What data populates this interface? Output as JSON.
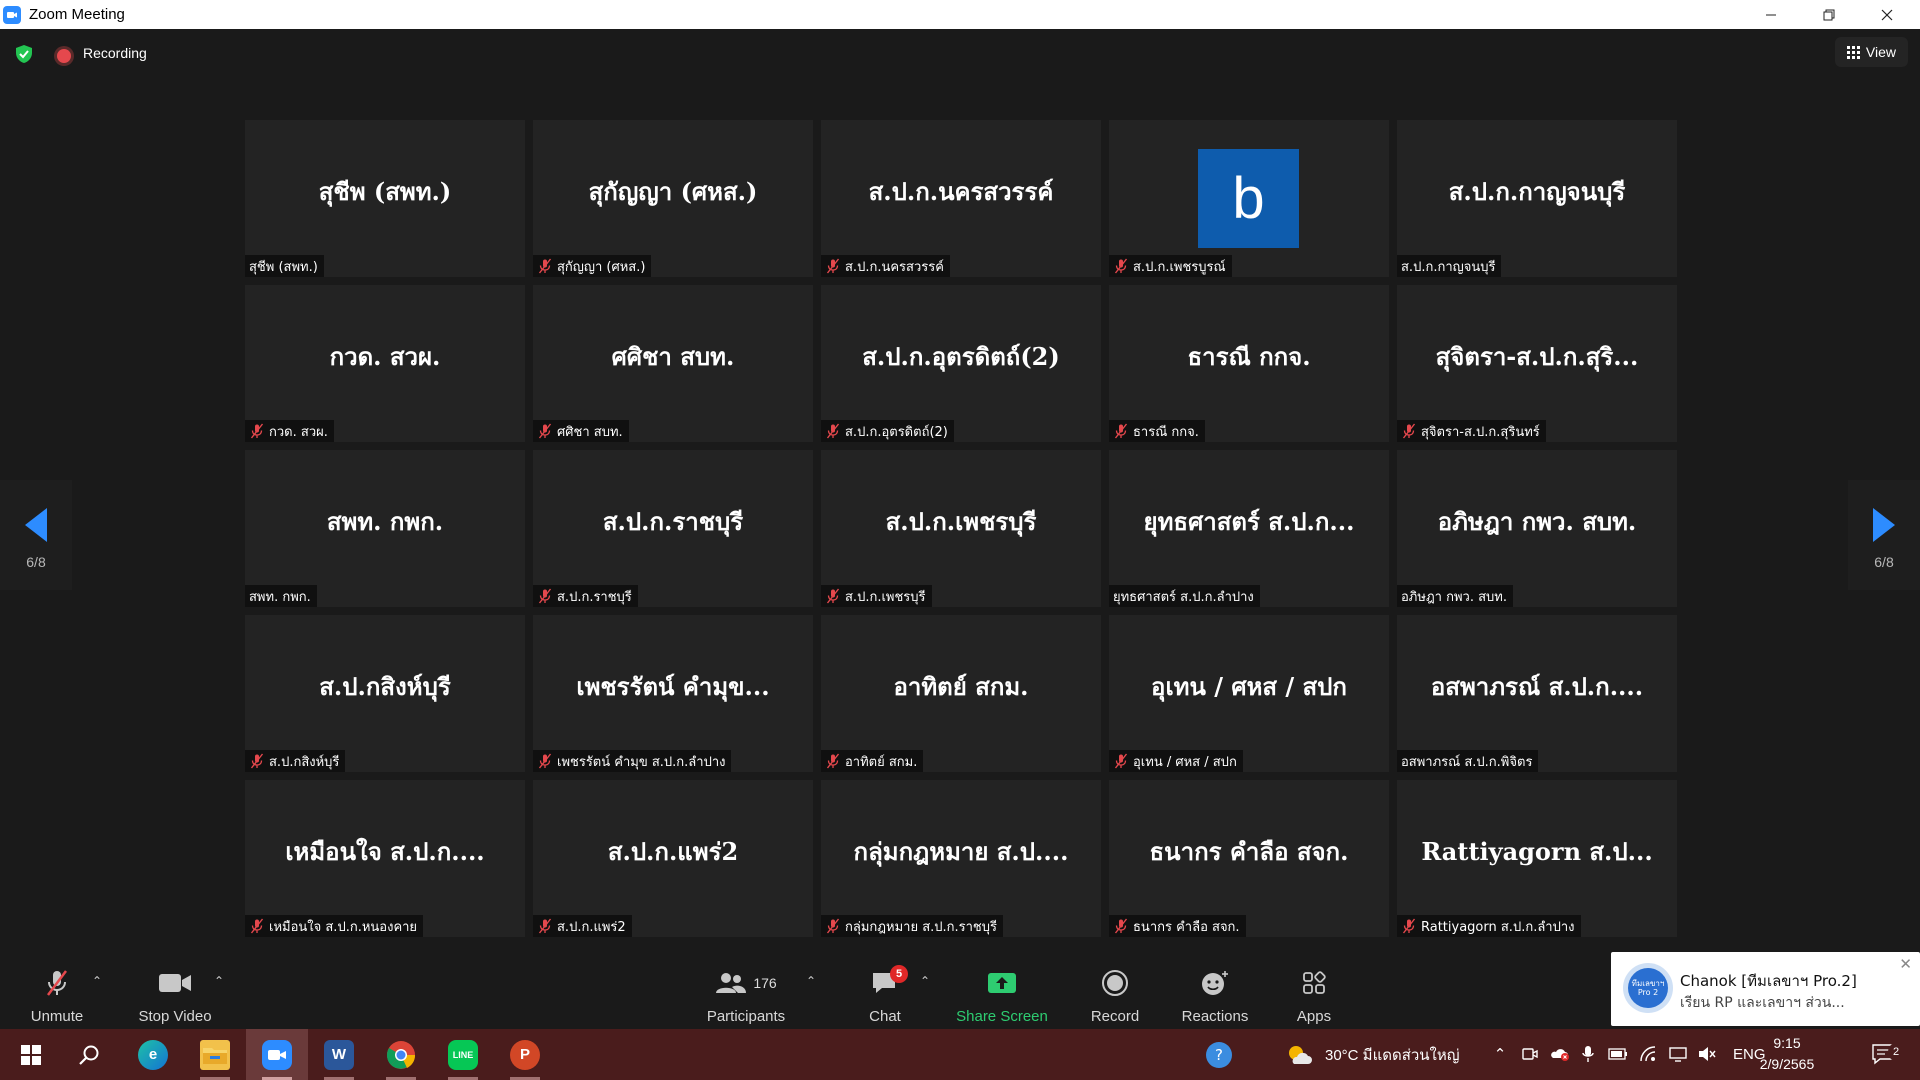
{
  "window": {
    "title": "Zoom Meeting"
  },
  "meeting_bar": {
    "recording_label": "Recording",
    "view_label": "View"
  },
  "pager": {
    "left_page": "6/8",
    "right_page": "6/8"
  },
  "tiles": [
    {
      "display": "สุชีพ (สพท.)",
      "tag": "สุชีพ (สพท.)",
      "muted": false
    },
    {
      "display": "สุกัญญา (ศหส.)",
      "tag": "สุกัญญา (ศหส.)",
      "muted": true
    },
    {
      "display": "ส.ป.ก.นครสวรรค์",
      "tag": "ส.ป.ก.นครสวรรค์",
      "muted": true
    },
    {
      "display": "b",
      "tag": "ส.ป.ก.เพชรบูรณ์",
      "muted": true,
      "avatar": true
    },
    {
      "display": "ส.ป.ก.กาญจนบุรี",
      "tag": "ส.ป.ก.กาญจนบุรี",
      "muted": false
    },
    {
      "display": "กวด. สวผ.",
      "tag": "กวด. สวผ.",
      "muted": true
    },
    {
      "display": "ศศิชา สบท.",
      "tag": "ศศิชา สบท.",
      "muted": true
    },
    {
      "display": "ส.ป.ก.อุตรดิตถ์(2)",
      "tag": "ส.ป.ก.อุตรดิตถ์(2)",
      "muted": true
    },
    {
      "display": "ธารณี กกจ.",
      "tag": "ธารณี กกจ.",
      "muted": true
    },
    {
      "display": "สุจิตรา-ส.ป.ก.สุริ...",
      "tag": "สุจิตรา-ส.ป.ก.สุรินทร์",
      "muted": true
    },
    {
      "display": "สพท. กพก.",
      "tag": "สพท. กพก.",
      "muted": false
    },
    {
      "display": "ส.ป.ก.ราชบุรี",
      "tag": "ส.ป.ก.ราชบุรี",
      "muted": true
    },
    {
      "display": "ส.ป.ก.เพชรบุรี",
      "tag": "ส.ป.ก.เพชรบุรี",
      "muted": true
    },
    {
      "display": "ยุทธศาสตร์ ส.ป.ก...",
      "tag": "ยุทธศาสตร์ ส.ป.ก.ลำปาง",
      "muted": false
    },
    {
      "display": "อภิษฎา กพว. สบท.",
      "tag": "อภิษฎา กพว. สบท.",
      "muted": false
    },
    {
      "display": "ส.ป.กสิงห์บุรี",
      "tag": "ส.ป.กสิงห์บุรี",
      "muted": true
    },
    {
      "display": "เพชรรัตน์ คำมุข...",
      "tag": "เพชรรัตน์ คำมุข ส.ป.ก.ลำปาง",
      "muted": true
    },
    {
      "display": "อาทิตย์ สกม.",
      "tag": "อาทิตย์ สกม.",
      "muted": true
    },
    {
      "display": "อุเทน / ศหส / สปก",
      "tag": "อุเทน / ศหส / สปก",
      "muted": true
    },
    {
      "display": "อสพาภรณ์ ส.ป.ก....",
      "tag": "อสพาภรณ์ ส.ป.ก.พิจิตร",
      "muted": false
    },
    {
      "display": "เหมือนใจ ส.ป.ก....",
      "tag": "เหมือนใจ ส.ป.ก.หนองคาย",
      "muted": true
    },
    {
      "display": "ส.ป.ก.แพร่2",
      "tag": "ส.ป.ก.แพร่2",
      "muted": true
    },
    {
      "display": "กลุ่มกฎหมาย ส.ป....",
      "tag": "กลุ่มกฎหมาย ส.ป.ก.ราชบุรี",
      "muted": true
    },
    {
      "display": "ธนากร คำลือ สจก.",
      "tag": "ธนากร คำลือ สจก.",
      "muted": true
    },
    {
      "display": "Rattiyagorn ส.ป...",
      "tag": "Rattiyagorn ส.ป.ก.ลำปาง",
      "muted": true
    }
  ],
  "toolbar": {
    "unmute": "Unmute",
    "stop_video": "Stop Video",
    "participants": "Participants",
    "participants_count": "176",
    "chat": "Chat",
    "chat_badge": "5",
    "share_screen": "Share Screen",
    "record": "Record",
    "reactions": "Reactions",
    "apps": "Apps"
  },
  "notification": {
    "sender": "Chanok [ทีมเลขาฯ Pro.2]",
    "message": "เรียน RP และเลขาฯ ส่วน...",
    "avatar_text": "ทีมเลขาฯ Pro 2"
  },
  "taskbar": {
    "weather": "30°C  มีแดดส่วนใหญ่",
    "language": "ENG",
    "time": "9:15",
    "date": "2/9/2565",
    "notif_count": "2"
  },
  "colors": {
    "accent": "#2d8cff",
    "share_green": "#2ecc71",
    "mute_red": "#e5484d",
    "tile_bg": "#232323"
  }
}
